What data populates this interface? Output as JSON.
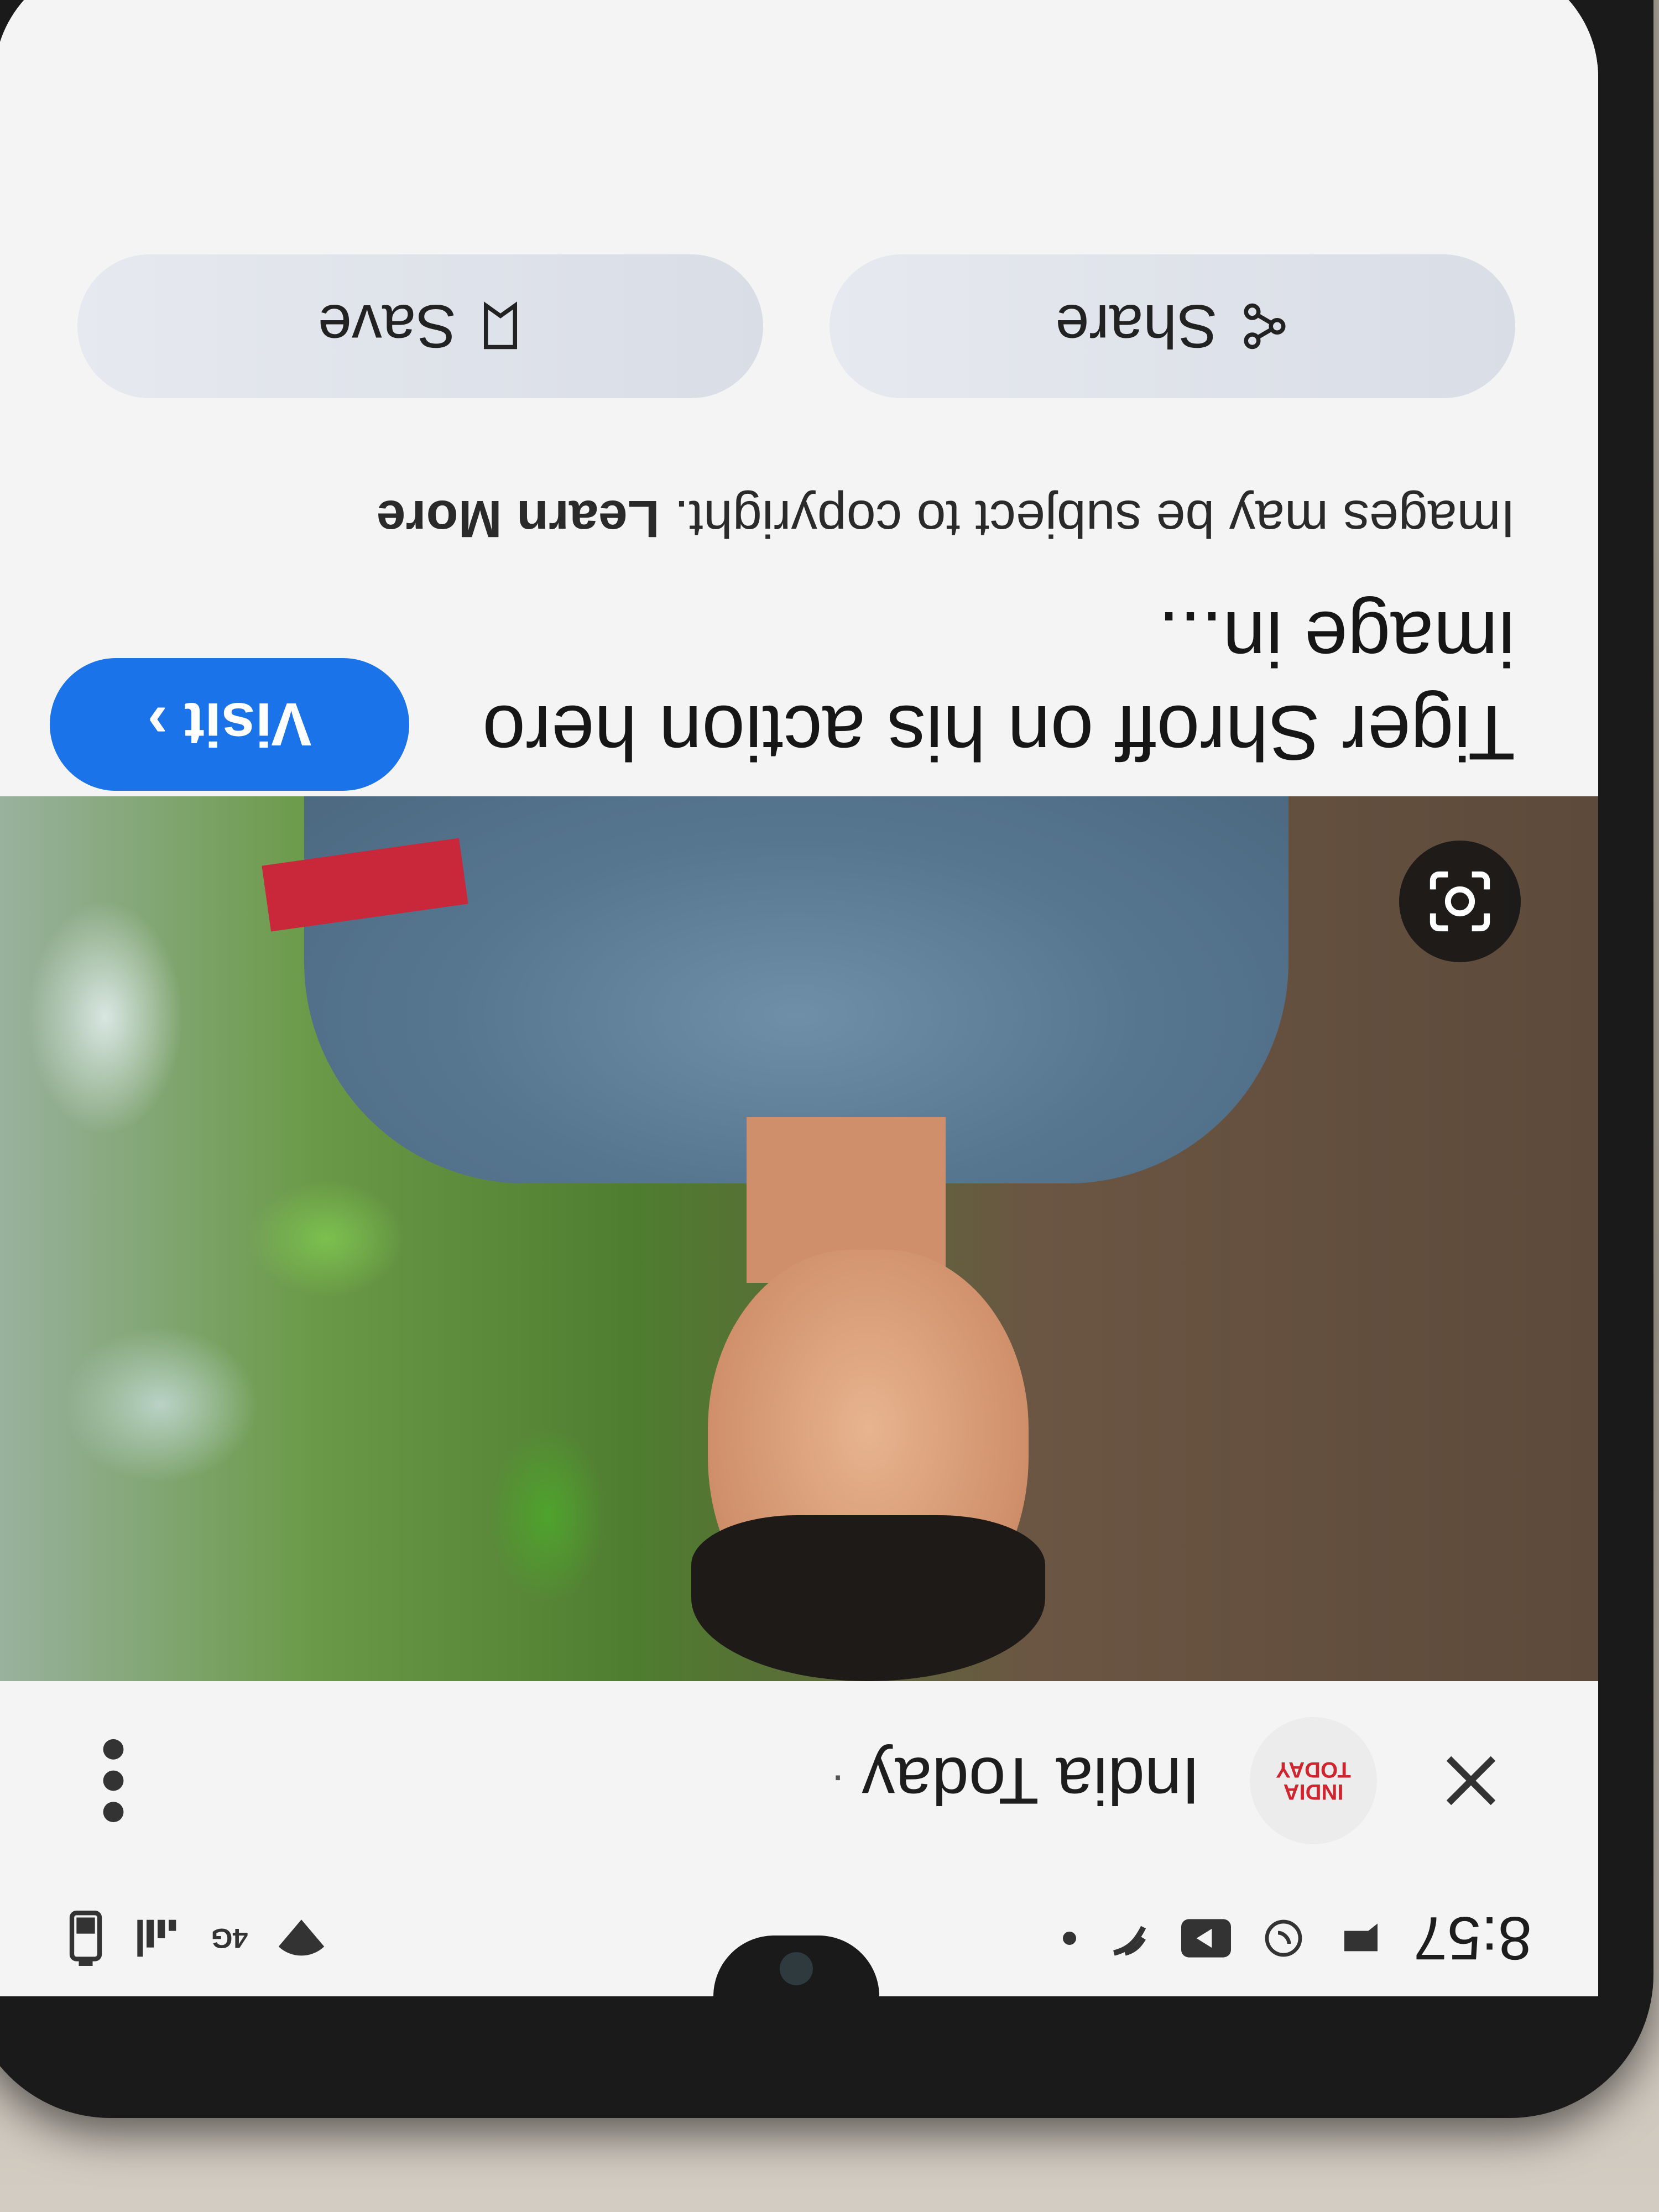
{
  "status_bar": {
    "time": "8:57",
    "network": "4G"
  },
  "header": {
    "source_name": "India Today",
    "separator": "·",
    "favicon_text": "INDIA TODAY"
  },
  "result": {
    "title": "Tiger Shroff on his action hero image in...",
    "visit_label": "Visit",
    "visit_chevron": "›",
    "copyright_text": "Images may be subject to copyright.",
    "learn_more": "Learn More"
  },
  "actions": {
    "share_label": "Share",
    "save_label": "Save"
  },
  "colors": {
    "accent": "#1a73e8",
    "brand_red": "#d0242f"
  },
  "icons": [
    "close-icon",
    "kebab-menu-icon",
    "lens-icon",
    "share-icon",
    "bookmark-icon",
    "signal-icon",
    "battery-icon",
    "wifi-icon"
  ]
}
